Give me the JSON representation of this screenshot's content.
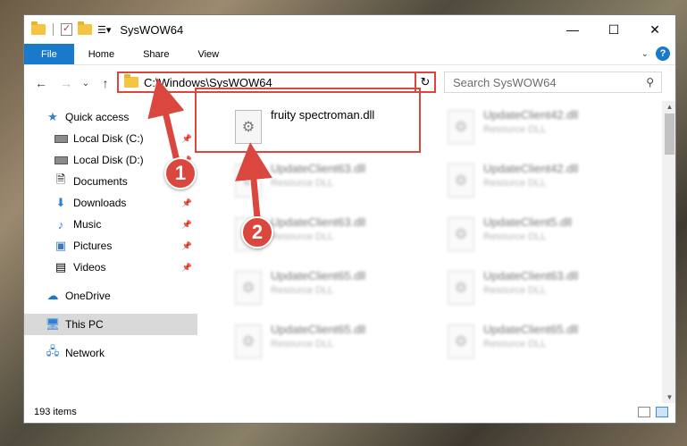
{
  "window": {
    "title": "SysWOW64",
    "controls": {
      "minimize": "—",
      "maximize": "☐",
      "close": "✕"
    }
  },
  "ribbon": {
    "tabs": [
      "File",
      "Home",
      "Share",
      "View"
    ],
    "help": "?"
  },
  "nav": {
    "back": "←",
    "forward": "→",
    "recent": "⌄",
    "up": "↑",
    "address": "C:\\Windows\\SysWOW64",
    "refresh": "↻",
    "search_placeholder": "Search SysWOW64"
  },
  "sidebar": {
    "items": [
      {
        "label": "Quick access",
        "icon": "star-icon"
      },
      {
        "label": "Local Disk (C:)",
        "icon": "disk-icon"
      },
      {
        "label": "Local Disk (D:)",
        "icon": "disk-icon"
      },
      {
        "label": "Documents",
        "icon": "documents-icon"
      },
      {
        "label": "Downloads",
        "icon": "download-icon"
      },
      {
        "label": "Music",
        "icon": "music-icon"
      },
      {
        "label": "Pictures",
        "icon": "pictures-icon"
      },
      {
        "label": "Videos",
        "icon": "videos-icon"
      },
      {
        "label": "OneDrive",
        "icon": "cloud-icon"
      },
      {
        "label": "This PC",
        "icon": "pc-icon"
      },
      {
        "label": "Network",
        "icon": "network-icon"
      }
    ]
  },
  "files": {
    "featured": {
      "name": "fruity spectroman.dll",
      "type": ""
    },
    "blurred": [
      {
        "name": "UpdateClient42.dll",
        "type": "Resource DLL"
      },
      {
        "name": "UpdateClient63.dll",
        "type": "Resource DLL"
      },
      {
        "name": "UpdateClient42.dll",
        "type": "Resource DLL"
      },
      {
        "name": "UpdateClient63.dll",
        "type": "Resource DLL"
      },
      {
        "name": "UpdateClient5.dll",
        "type": "Resource DLL"
      },
      {
        "name": "UpdateClient65.dll",
        "type": "Resource DLL"
      },
      {
        "name": "UpdateClient63.dll",
        "type": "Resource DLL"
      },
      {
        "name": "UpdateClient65.dll",
        "type": "Resource DLL"
      },
      {
        "name": "UpdateClient65.dll",
        "type": "Resource DLL"
      }
    ]
  },
  "status": {
    "count": "193 items"
  },
  "annotations": {
    "step1": "1",
    "step2": "2",
    "color": "#d9473f"
  }
}
